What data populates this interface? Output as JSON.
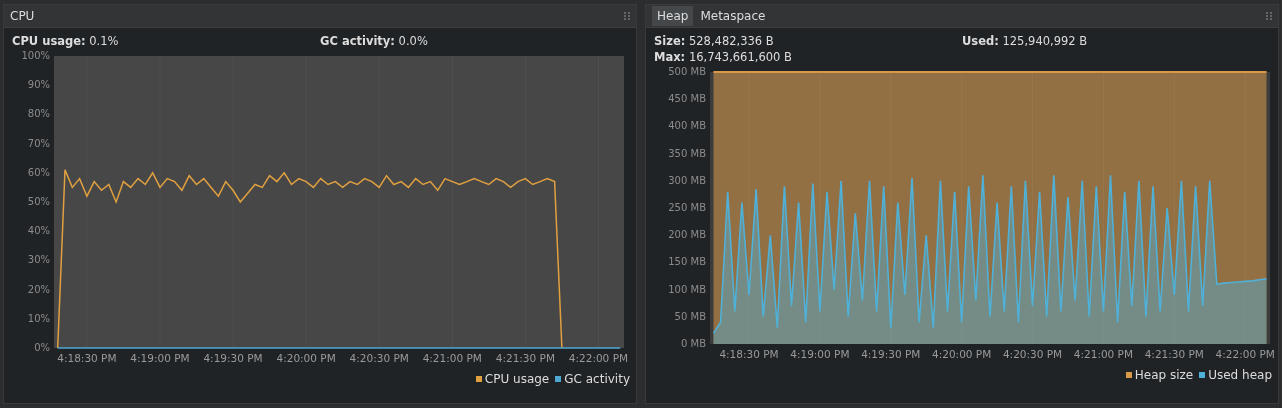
{
  "cpu": {
    "title": "CPU",
    "stats": [
      "**CPU usage:** 0.1%",
      "**GC activity:** 0.0%"
    ],
    "chart_data": {
      "type": "line",
      "grid": true,
      "ylim": [
        0,
        100
      ],
      "yticks": [
        {
          "value": 0,
          "label": "0%"
        },
        {
          "value": 10,
          "label": "10%"
        },
        {
          "value": 20,
          "label": "20%"
        },
        {
          "value": 30,
          "label": "30%"
        },
        {
          "value": 40,
          "label": "40%"
        },
        {
          "value": 50,
          "label": "50%"
        },
        {
          "value": 60,
          "label": "60%"
        },
        {
          "value": 70,
          "label": "70%"
        },
        {
          "value": 80,
          "label": "80%"
        },
        {
          "value": 90,
          "label": "90%"
        },
        {
          "value": 100,
          "label": "100%"
        }
      ],
      "categories": [
        null,
        null,
        null,
        null,
        "4:18:30 PM",
        null,
        null,
        null,
        null,
        null,
        null,
        null,
        null,
        null,
        "4:19:00 PM",
        null,
        null,
        null,
        null,
        null,
        null,
        null,
        null,
        null,
        "4:19:30 PM",
        null,
        null,
        null,
        null,
        null,
        null,
        null,
        null,
        null,
        "4:20:00 PM",
        null,
        null,
        null,
        null,
        null,
        null,
        null,
        null,
        null,
        "4:20:30 PM",
        null,
        null,
        null,
        null,
        null,
        null,
        null,
        null,
        null,
        "4:21:00 PM",
        null,
        null,
        null,
        null,
        null,
        null,
        null,
        null,
        null,
        "4:21:30 PM",
        null,
        null,
        null,
        null,
        null,
        null,
        null,
        null,
        null,
        "4:22:00 PM",
        null,
        null,
        null
      ],
      "series": [
        {
          "name": "CPU usage",
          "color": "#e0a040",
          "values": [
            0,
            61,
            55,
            58,
            52,
            57,
            54,
            56,
            50,
            57,
            55,
            58,
            56,
            60,
            55,
            58,
            57,
            54,
            59,
            56,
            58,
            55,
            52,
            57,
            54,
            50,
            53,
            56,
            55,
            59,
            57,
            60,
            56,
            58,
            57,
            55,
            58,
            56,
            57,
            55,
            57,
            56,
            58,
            57,
            55,
            59,
            56,
            57,
            55,
            58,
            56,
            57,
            54,
            58,
            57,
            56,
            57,
            58,
            57,
            56,
            58,
            57,
            55,
            57,
            58,
            56,
            57,
            58,
            57,
            0,
            null,
            null,
            null,
            null,
            null,
            null,
            null,
            null
          ]
        },
        {
          "name": "GC activity",
          "color": "#4fa8d0",
          "values": [
            0,
            0,
            0,
            0,
            0,
            0,
            0,
            0,
            0,
            0,
            0,
            0,
            0,
            0,
            0,
            0,
            0,
            0,
            0,
            0,
            0,
            0,
            0,
            0,
            0,
            0,
            0,
            0,
            0,
            0,
            0,
            0,
            0,
            0,
            0,
            0,
            0,
            0,
            0,
            0,
            0,
            0,
            0,
            0,
            0,
            0,
            0,
            0,
            0,
            0,
            0,
            0,
            0,
            0,
            0,
            0,
            0,
            0,
            0,
            0,
            0,
            0,
            0,
            0,
            0,
            0,
            0,
            0,
            0,
            0,
            0,
            0,
            0,
            0,
            0,
            0,
            0,
            0
          ]
        }
      ]
    }
  },
  "memory": {
    "tabs": [
      {
        "label": "Heap",
        "selected": true
      },
      {
        "label": "Metaspace",
        "selected": false
      }
    ],
    "stats": [
      "**Size:** 528,482,336 B",
      "**Used:** 125,940,992 B",
      "**Max:** 16,743,661,600 B"
    ],
    "chart_data": {
      "type": "area",
      "grid": true,
      "ylim": [
        0,
        500
      ],
      "yticks": [
        {
          "value": 0,
          "label": "0 MB"
        },
        {
          "value": 50,
          "label": "50 MB"
        },
        {
          "value": 100,
          "label": "100 MB"
        },
        {
          "value": 150,
          "label": "150 MB"
        },
        {
          "value": 200,
          "label": "200 MB"
        },
        {
          "value": 250,
          "label": "250 MB"
        },
        {
          "value": 300,
          "label": "300 MB"
        },
        {
          "value": 350,
          "label": "350 MB"
        },
        {
          "value": 400,
          "label": "400 MB"
        },
        {
          "value": 450,
          "label": "450 MB"
        },
        {
          "value": 500,
          "label": "500 MB"
        }
      ],
      "categories": [
        null,
        null,
        null,
        null,
        null,
        "4:18:30 PM",
        null,
        null,
        null,
        null,
        null,
        null,
        null,
        null,
        null,
        "4:19:00 PM",
        null,
        null,
        null,
        null,
        null,
        null,
        null,
        null,
        null,
        "4:19:30 PM",
        null,
        null,
        null,
        null,
        null,
        null,
        null,
        null,
        null,
        "4:20:00 PM",
        null,
        null,
        null,
        null,
        null,
        null,
        null,
        null,
        null,
        "4:20:30 PM",
        null,
        null,
        null,
        null,
        null,
        null,
        null,
        null,
        null,
        "4:21:00 PM",
        null,
        null,
        null,
        null,
        null,
        null,
        null,
        null,
        null,
        "4:21:30 PM",
        null,
        null,
        null,
        null,
        null,
        null,
        null,
        null,
        null,
        "4:22:00 PM",
        null,
        null,
        null
      ],
      "series": [
        {
          "name": "Heap size",
          "color": "#d89a48",
          "values": [
            500,
            500,
            500,
            500,
            500,
            500,
            500,
            500,
            500,
            500,
            500,
            500,
            500,
            500,
            500,
            500,
            500,
            500,
            500,
            500,
            500,
            500,
            500,
            500,
            500,
            500,
            500,
            500,
            500,
            500,
            500,
            500,
            500,
            500,
            500,
            500,
            500,
            500,
            500,
            500,
            500,
            500,
            500,
            500,
            500,
            500,
            500,
            500,
            500,
            500,
            500,
            500,
            500,
            500,
            500,
            500,
            500,
            500,
            500,
            500,
            500,
            500,
            500,
            500,
            500,
            500,
            500,
            500,
            500,
            500,
            500,
            500,
            500,
            500,
            500,
            500,
            500,
            500,
            500
          ]
        },
        {
          "name": "Used heap",
          "color": "#4fb0d8",
          "values": [
            20,
            40,
            280,
            60,
            260,
            90,
            285,
            50,
            200,
            30,
            290,
            70,
            260,
            40,
            295,
            60,
            280,
            100,
            300,
            50,
            240,
            80,
            300,
            60,
            290,
            30,
            260,
            90,
            305,
            40,
            200,
            30,
            300,
            60,
            280,
            40,
            290,
            80,
            310,
            50,
            260,
            60,
            290,
            40,
            300,
            70,
            280,
            50,
            310,
            60,
            270,
            80,
            300,
            50,
            290,
            60,
            310,
            40,
            280,
            70,
            300,
            50,
            290,
            60,
            250,
            90,
            300,
            60,
            290,
            70,
            300,
            110,
            112,
            113,
            114,
            115,
            116,
            118,
            120
          ]
        }
      ]
    }
  }
}
